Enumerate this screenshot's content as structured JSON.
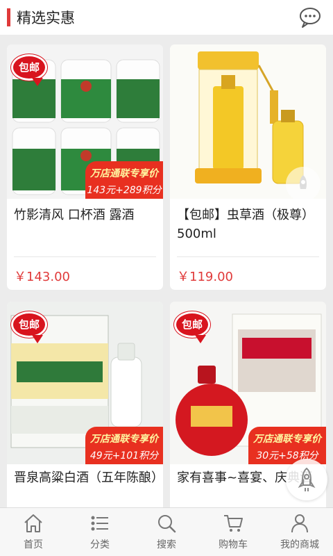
{
  "header": {
    "title": "精选实惠",
    "chat_icon": "chat-bubble-icon"
  },
  "badge_text": "包邮",
  "products": [
    {
      "name": "竹影清风 口杯酒 露酒",
      "price": "￥143.00",
      "has_promo": true,
      "promo_l1": "万店通联专享价",
      "promo_l2": "143元+289积分",
      "has_badge": true
    },
    {
      "name": "【包邮】虫草酒（极尊）500ml",
      "price": "￥119.00",
      "has_promo": false,
      "has_badge": false
    },
    {
      "name": "晋泉高粱白酒（五年陈酿）",
      "price": "",
      "has_promo": true,
      "promo_l1": "万店通联专享价",
      "promo_l2": "49元+101积分",
      "has_badge": true
    },
    {
      "name": "家有喜事~喜宴、庆典酒",
      "price": "",
      "has_promo": true,
      "promo_l1": "万店通联专享价",
      "promo_l2": "30元+58积分",
      "has_badge": true
    }
  ],
  "tabs": [
    {
      "label": "首页",
      "icon": "home-icon"
    },
    {
      "label": "分类",
      "icon": "list-icon"
    },
    {
      "label": "搜索",
      "icon": "search-icon"
    },
    {
      "label": "购物车",
      "icon": "cart-icon"
    },
    {
      "label": "我的商城",
      "icon": "user-icon"
    }
  ],
  "colors": {
    "accent": "#e03a3a",
    "badge": "#d8141e",
    "promo": "#e83020"
  }
}
